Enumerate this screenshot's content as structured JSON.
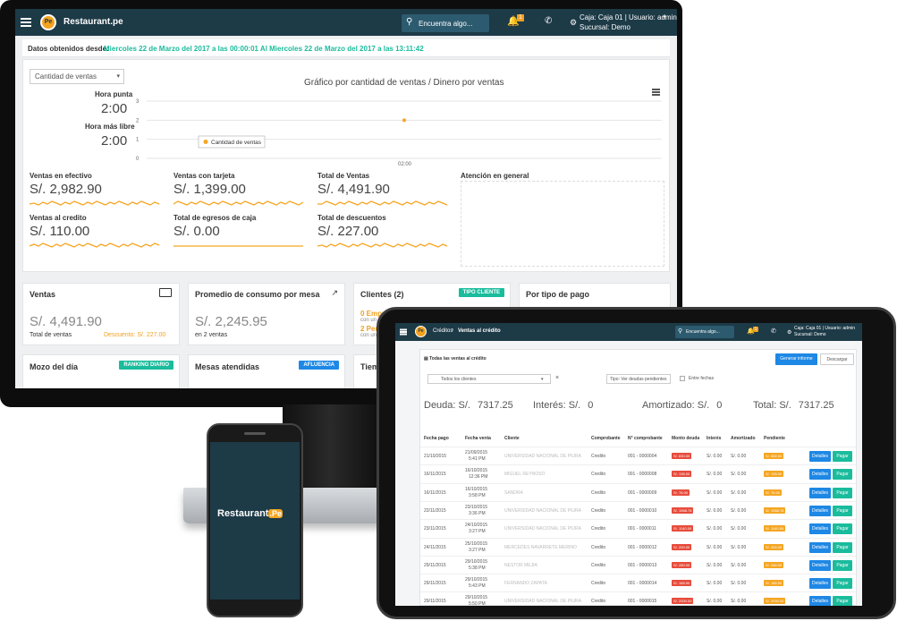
{
  "app": {
    "name": "Restaurant.pe",
    "logo_letters": "Pe"
  },
  "topbar": {
    "search_placeholder": "Encuentra algo...",
    "notif_count": "1",
    "user_line1": "Caja: Caja 01 | Usuario: admin",
    "user_line2": "Sucursal: Demo"
  },
  "dashboard": {
    "date_range_label": "Datos obtenidos desde:",
    "date_range_value": "Miercoles 22 de Marzo del 2017 a las 00:00:01 Al Miercoles 22 de Marzo del 2017 a las 13:11:42",
    "select_value": "Cantidad de ventas",
    "peak_label": "Hora punta",
    "peak_value": "2:00",
    "free_label": "Hora más libre",
    "free_value": "2:00",
    "chart_title": "Gráfico por cantidad de ventas",
    "chart_sep": "/",
    "chart_title2": "Dinero por ventas",
    "stats": [
      {
        "label": "Ventas en efectivo",
        "value": "S/. 2,982.90"
      },
      {
        "label": "Ventas con tarjeta",
        "value": "S/. 1,399.00"
      },
      {
        "label": "Total de Ventas",
        "value": "S/. 4,491.90"
      },
      {
        "label": "Ventas al credito",
        "value": "S/. 110.00"
      },
      {
        "label": "Total de egresos de caja",
        "value": "S/. 0.00"
      },
      {
        "label": "Total de descuentos",
        "value": "S/. 227.00"
      }
    ],
    "attention_label": "Atención en general",
    "cards": {
      "ventas_title": "Ventas",
      "ventas_value": "S/. 4,491.90",
      "ventas_sub": "Total de ventas",
      "ventas_discount": "Descuento: S/. 227.00",
      "promedio_title": "Promedio de consumo por mesa",
      "promedio_value": "S/. 2,245.95",
      "promedio_sub": "en 2 ventas",
      "clientes_title": "Clientes (2)",
      "clientes_badge": "TIPO CLIENTE",
      "clientes_line1": "0 Empre",
      "clientes_line1b": "con un",
      "clientes_line2": "2 Pers",
      "clientes_line2b": "con un",
      "pago_title": "Por tipo de pago",
      "mozo_title": "Mozo del día",
      "mozo_badge": "RANKING DIARIO",
      "mesas_title": "Mesas atendidas",
      "mesas_badge": "AFLUENCIA",
      "tiempo_title": "Tiemp"
    }
  },
  "chart_data": {
    "type": "line",
    "title": "Gráfico por cantidad de ventas",
    "x": [
      "02:00"
    ],
    "series": [
      {
        "name": "Cantidad de ventas",
        "values": [
          2
        ]
      }
    ],
    "ylim": [
      0,
      3
    ],
    "yticks": [
      "3",
      "2",
      "1",
      "0"
    ],
    "legend": "bottom-left",
    "grid": true,
    "color": "#f5a623"
  },
  "tablet": {
    "breadcrumb1": "Créditos",
    "breadcrumb2": "Ventas al crédito",
    "section_title": "Todas las ventas al crédito",
    "btn_report": "Generar informe",
    "btn_download": "Descargar",
    "filter_clients": "Todos los clientes",
    "filter_clear": "×",
    "filter_type": "Tipo: Ver deudas pendientes",
    "filter_dates": "Entre fechas",
    "summary": [
      {
        "label": "Deuda: S/.",
        "value": "7317.25"
      },
      {
        "label": "Interés: S/.",
        "value": "0"
      },
      {
        "label": "Amortizado: S/.",
        "value": "0"
      },
      {
        "label": "Total: S/.",
        "value": "7317.25"
      }
    ],
    "columns": [
      "Fecha pago",
      "Fecha venta",
      "Cliente",
      "Comprobante",
      "N° comprobante",
      "Monto deuda",
      "Interés",
      "Amortizado",
      "Pendiente"
    ],
    "btn_details": "Detalles",
    "btn_pay": "Pagar",
    "rows": [
      {
        "pago": "21/10/2015",
        "venta": "21/09/2015",
        "hora": "5:41 PM",
        "cliente": "UNIVERSIDAD NACIONAL DE PIURA",
        "comp": "Credito",
        "num": "001 - 0000004",
        "monto": "S/. 830.00",
        "interes": "S/. 0.00",
        "amort": "S/. 0.00",
        "pend": "S/. 830.00"
      },
      {
        "pago": "16/11/2015",
        "venta": "16/10/2015",
        "hora": "12:36 PM",
        "cliente": "MIGUEL REYNOSO",
        "comp": "Credito",
        "num": "001 - 0000008",
        "monto": "S/. 135.00",
        "interes": "S/. 0.00",
        "amort": "S/. 0.00",
        "pend": "S/. 135.00"
      },
      {
        "pago": "16/11/2015",
        "venta": "16/10/2015",
        "hora": "3:58 PM",
        "cliente": "SANDRA",
        "comp": "Credito",
        "num": "001 - 0000009",
        "monto": "S/. 76.00",
        "interes": "S/. 0.00",
        "amort": "S/. 0.00",
        "pend": "S/. 76.00"
      },
      {
        "pago": "22/11/2015",
        "venta": "23/10/2015",
        "hora": "3:36 PM",
        "cliente": "UNIVERSIDAD NACIONAL DE PIURA",
        "comp": "Credito",
        "num": "001 - 0000010",
        "monto": "S/. 1568.78",
        "interes": "S/. 0.00",
        "amort": "S/. 0.00",
        "pend": "S/. 1568.78"
      },
      {
        "pago": "23/11/2015",
        "venta": "24/10/2015",
        "hora": "3:27 PM",
        "cliente": "UNIVERSIDAD NACIONAL DE PIURA",
        "comp": "Credito",
        "num": "001 - 0000011",
        "monto": "S/. 1140.00",
        "interes": "S/. 0.00",
        "amort": "S/. 0.00",
        "pend": "S/. 1140.00"
      },
      {
        "pago": "24/11/2015",
        "venta": "25/10/2015",
        "hora": "3:27 PM",
        "cliente": "MERCEDES NAVARRETE MERINO",
        "comp": "Credito",
        "num": "001 - 0000012",
        "monto": "S/. 200.00",
        "interes": "S/. 0.00",
        "amort": "S/. 0.00",
        "pend": "S/. 200.00"
      },
      {
        "pago": "29/11/2015",
        "venta": "29/10/2015",
        "hora": "5:38 PM",
        "cliente": "NESTOR MEJIA",
        "comp": "Credito",
        "num": "001 - 0000013",
        "monto": "S/. 280.00",
        "interes": "S/. 0.00",
        "amort": "S/. 0.00",
        "pend": "S/. 280.00"
      },
      {
        "pago": "29/11/2015",
        "venta": "29/10/2015",
        "hora": "5:43 PM",
        "cliente": "FERNANDO ZAPATA",
        "comp": "Credito",
        "num": "001 - 0000014",
        "monto": "S/. 185.90",
        "interes": "S/. 0.00",
        "amort": "S/. 0.00",
        "pend": "S/. 185.90"
      },
      {
        "pago": "29/11/2015",
        "venta": "29/10/2015",
        "hora": "5:50 PM",
        "cliente": "UNIVERSIDAD NACIONAL DE PIURA",
        "comp": "Credito",
        "num": "001 - 0000015",
        "monto": "S/. 2000.00",
        "interes": "S/. 0.00",
        "amort": "S/. 0.00",
        "pend": "S/. 2000.00"
      }
    ]
  },
  "phone": {
    "brand": "Restaurant",
    "brand_suffix": ".Pe"
  },
  "colors": {
    "navy": "#1d3a47",
    "orange": "#f5a623",
    "teal": "#1abc9c",
    "blue": "#1e88e5",
    "red": "#e74c3c"
  },
  "icons": [
    "menu-icon",
    "search-icon",
    "bell-icon",
    "phone-icon",
    "gear-icon",
    "money-icon",
    "trend-icon",
    "calendar-icon"
  ]
}
